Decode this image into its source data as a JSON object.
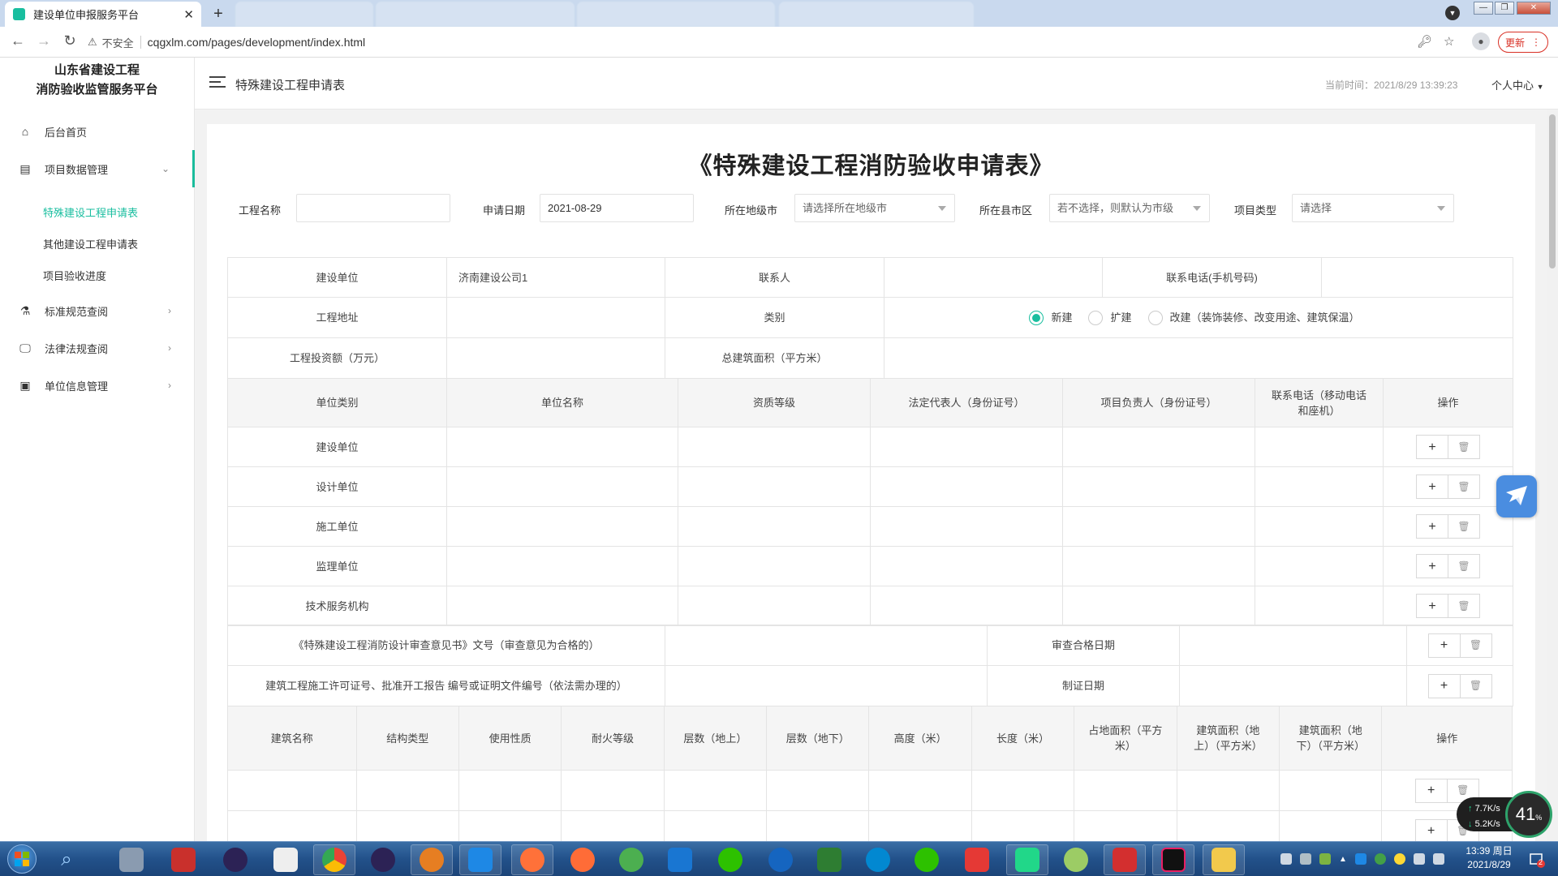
{
  "browser": {
    "active_tab_title": "建设单位申报服务平台",
    "url": "cqgxlm.com/pages/development/index.html",
    "security_label": "不安全",
    "update_label": "更新"
  },
  "sidebar": {
    "brand_line1": "山东省建设工程",
    "brand_line2": "消防验收监管服务平台",
    "items": [
      {
        "label": "后台首页",
        "icon": "home-icon"
      },
      {
        "label": "项目数据管理",
        "icon": "document-stack-icon"
      },
      {
        "label": "标准规范查阅",
        "icon": "flask-icon"
      },
      {
        "label": "法律法规查阅",
        "icon": "monitor-icon"
      },
      {
        "label": "单位信息管理",
        "icon": "id-card-icon"
      }
    ],
    "sub_items": [
      {
        "label": "特殊建设工程申请表",
        "active": true
      },
      {
        "label": "其他建设工程申请表",
        "active": false
      },
      {
        "label": "项目验收进度",
        "active": false
      }
    ]
  },
  "header": {
    "title": "特殊建设工程申请表",
    "time": "当前时间：2021/8/29 13:39:23",
    "user_menu": "个人中心"
  },
  "form": {
    "title": "《特殊建设工程消防验收申请表》",
    "filters": {
      "project_name_label": "工程名称",
      "project_name_value": "",
      "apply_date_label": "申请日期",
      "apply_date_value": "2021-08-29",
      "city_label": "所在地级市",
      "city_placeholder": "请选择所在地级市",
      "county_label": "所在县市区",
      "county_placeholder": "若不选择，则默认为市级",
      "type_label": "项目类型",
      "type_placeholder": "请选择"
    },
    "basic": {
      "builder_label": "建设单位",
      "builder_value": "济南建设公司1",
      "contact_label": "联系人",
      "contact_value": "",
      "phone_label": "联系电话(手机号码)",
      "phone_value": "",
      "address_label": "工程地址",
      "category_label": "类别",
      "category_options": [
        "新建",
        "扩建",
        "改建（装饰装修、改变用途、建筑保温）"
      ],
      "category_selected": "新建",
      "investment_label": "工程投资额（万元）",
      "area_label": "总建筑面积（平方米）"
    },
    "units": {
      "headers": [
        "单位类别",
        "单位名称",
        "资质等级",
        "法定代表人（身份证号）",
        "项目负责人（身份证号）",
        "联系电话（移动电话和座机）",
        "操作"
      ],
      "rows": [
        "建设单位",
        "设计单位",
        "施工单位",
        "监理单位",
        "技术服务机构"
      ]
    },
    "docs": [
      {
        "label": "《特殊建设工程消防设计审查意见书》文号（审查意见为合格的）",
        "date_label": "审查合格日期"
      },
      {
        "label": "建筑工程施工许可证号、批准开工报告 编号或证明文件编号（依法需办理的）",
        "date_label": "制证日期"
      }
    ],
    "buildings": {
      "headers": [
        "建筑名称",
        "结构类型",
        "使用性质",
        "耐火等级",
        "层数（地上）",
        "层数（地下）",
        "高度（米）",
        "长度（米）",
        "占地面积（平方米）",
        "建筑面积（地上）（平方米）",
        "建筑面积（地下）（平方米）",
        "操作"
      ],
      "row_count": 2
    },
    "op_add_icon": "plus-icon",
    "op_delete_icon": "trash-icon"
  },
  "widgets": {
    "net_up": "7.7K/s",
    "net_down": "5.2K/s",
    "usage_percent": "41"
  },
  "taskbar": {
    "clock_time": "13:39 周日",
    "clock_date": "2021/8/29",
    "notification_count": "2"
  }
}
